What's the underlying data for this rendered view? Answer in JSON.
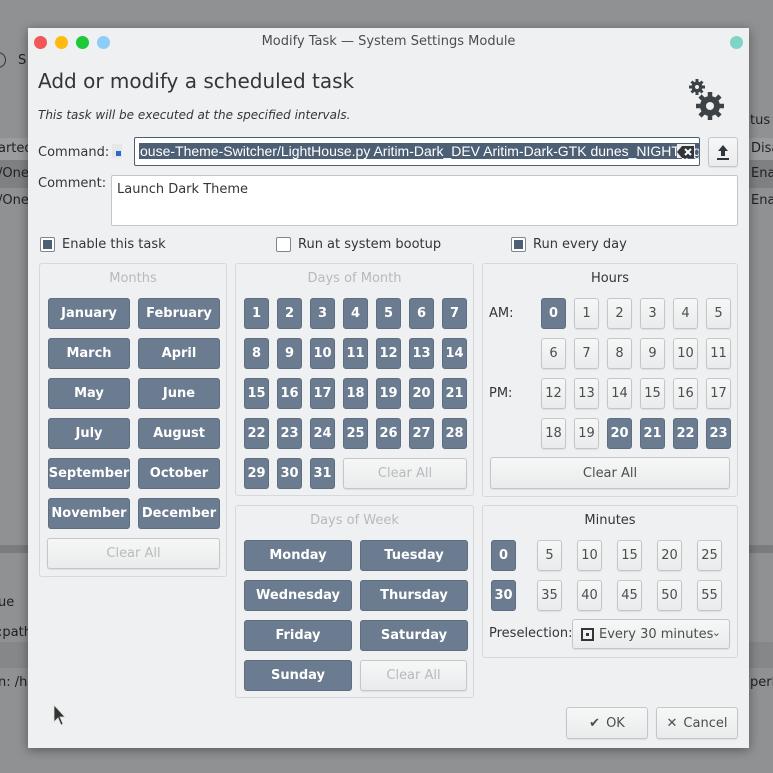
{
  "background": {
    "fragments": [
      "S",
      "arted",
      "/One",
      "/One",
      "tus",
      "Disa",
      "Enab",
      "Enab",
      "ue",
      ":path",
      "n: /ho",
      "perl:A"
    ]
  },
  "window": {
    "title": "Modify Task — System Settings Module"
  },
  "header": {
    "title": "Add or modify a scheduled task",
    "subtitle": "This task will be executed at the specified intervals.",
    "icon": "gears-icon"
  },
  "command": {
    "label": "Command:",
    "value": "ouse-Theme-Switcher/LightHouse.py Aritim-Dark_DEV Aritim-Dark-GTK dunes_NIGHT.jpg"
  },
  "comment": {
    "label": "Comment:",
    "value": "Launch Dark Theme"
  },
  "options": [
    {
      "label": "Enable this task",
      "checked": true
    },
    {
      "label": "Run at system bootup",
      "checked": false
    },
    {
      "label": "Run every day",
      "checked": true
    }
  ],
  "months": {
    "title": "Months",
    "items": [
      "January",
      "February",
      "March",
      "April",
      "May",
      "June",
      "July",
      "August",
      "September",
      "October",
      "November",
      "December"
    ],
    "selected": [
      1,
      2,
      3,
      4,
      5,
      6,
      7,
      8,
      9,
      10,
      11,
      12
    ],
    "clear": "Clear All"
  },
  "days_of_month": {
    "title": "Days of Month",
    "selected_all": true,
    "clear": "Clear All"
  },
  "days_of_week": {
    "title": "Days of Week",
    "items": [
      "Monday",
      "Tuesday",
      "Wednesday",
      "Thursday",
      "Friday",
      "Saturday",
      "Sunday"
    ],
    "clear": "Clear All"
  },
  "hours": {
    "title": "Hours",
    "am_label": "AM:",
    "pm_label": "PM:",
    "selected": [
      0,
      20,
      21,
      22,
      23
    ],
    "clear": "Clear All"
  },
  "minutes": {
    "title": "Minutes",
    "items": [
      0,
      5,
      10,
      15,
      20,
      25,
      30,
      35,
      40,
      45,
      50,
      55
    ],
    "selected": [
      0,
      30
    ],
    "preselection_label": "Preselection:",
    "preselection_value": "Every 30 minutes"
  },
  "buttons": {
    "ok": "OK",
    "cancel": "Cancel"
  },
  "colors": {
    "selected": "#6b7c90",
    "accent": "#4d5f74"
  }
}
